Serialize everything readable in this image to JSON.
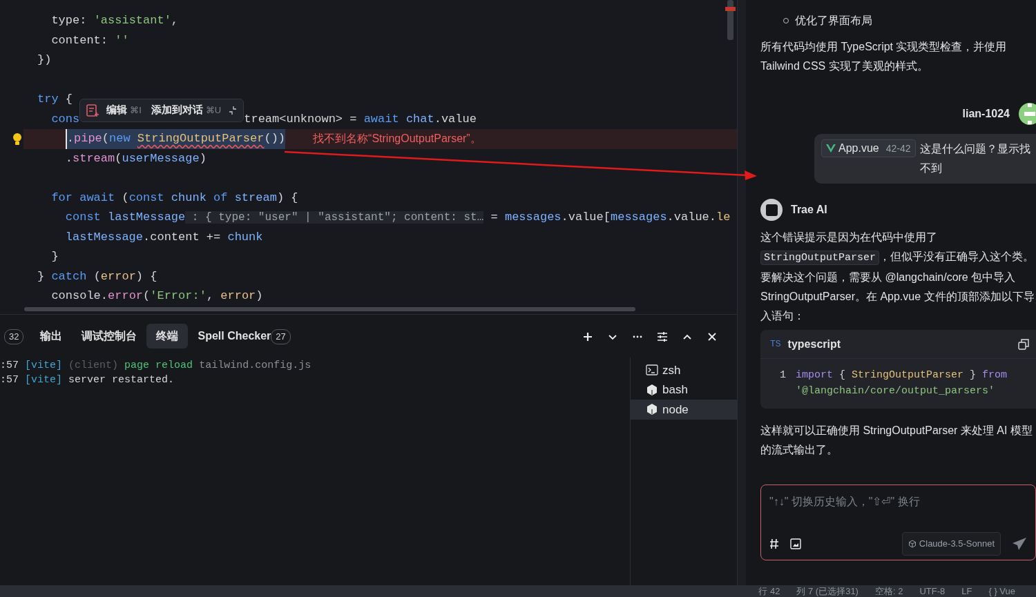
{
  "editor": {
    "lines": [
      {
        "kind": "code",
        "tokens": [
          {
            "t": "  type: ",
            "kind": "plain"
          },
          {
            "t": "'assistant'",
            "kind": "str"
          },
          {
            "t": ",",
            "kind": "plain"
          }
        ]
      },
      {
        "kind": "code",
        "tokens": [
          {
            "t": "  content: ",
            "kind": "plain"
          },
          {
            "t": "''",
            "kind": "str"
          }
        ]
      },
      {
        "kind": "code",
        "tokens": [
          {
            "t": "})",
            "kind": "plain"
          }
        ]
      },
      {
        "kind": "blank"
      },
      {
        "kind": "code",
        "tokens": [
          {
            "t": "try",
            "kind": "kw"
          },
          {
            "t": " {",
            "kind": "plain"
          }
        ]
      },
      {
        "kind": "covered",
        "before": [
          {
            "t": "  cons",
            "kind": "kw"
          }
        ],
        "after": [
          {
            "t": "tream<unknown> = ",
            "kind": "plain"
          },
          {
            "t": "await ",
            "kind": "kw"
          },
          {
            "t": "chat",
            "kind": "var"
          },
          {
            "t": ".value",
            "kind": "plain"
          }
        ]
      },
      {
        "kind": "error",
        "selection": [
          {
            "t": ".",
            "kind": "plain"
          },
          {
            "t": "pipe",
            "kind": "fn"
          },
          {
            "t": "(",
            "kind": "plain"
          },
          {
            "t": "new ",
            "kind": "kw"
          },
          {
            "t": "StringOutputParser",
            "kind": "unresolved"
          },
          {
            "t": "())",
            "kind": "plain"
          }
        ],
        "message": "找不到名称“StringOutputParser”。"
      },
      {
        "kind": "code",
        "tokens": [
          {
            "t": "    .",
            "kind": "plain"
          },
          {
            "t": "stream",
            "kind": "fn"
          },
          {
            "t": "(",
            "kind": "plain"
          },
          {
            "t": "userMessage",
            "kind": "var"
          },
          {
            "t": ")",
            "kind": "plain"
          }
        ]
      },
      {
        "kind": "blank"
      },
      {
        "kind": "code",
        "tokens": [
          {
            "t": "  for await ",
            "kind": "kw"
          },
          {
            "t": "(",
            "kind": "plain"
          },
          {
            "t": "const ",
            "kind": "kw"
          },
          {
            "t": "chunk ",
            "kind": "var"
          },
          {
            "t": "of ",
            "kind": "kw"
          },
          {
            "t": "stream",
            "kind": "var"
          },
          {
            "t": ") {",
            "kind": "plain"
          }
        ]
      },
      {
        "kind": "code",
        "tokens": [
          {
            "t": "    const ",
            "kind": "kw"
          },
          {
            "t": "lastMessage",
            "kind": "var"
          },
          {
            "t": " : { type: \"user\" | \"assistant\"; content: st…",
            "kind": "hint"
          },
          {
            "t": " = ",
            "kind": "plain"
          },
          {
            "t": "messages",
            "kind": "var"
          },
          {
            "t": ".value[",
            "kind": "plain"
          },
          {
            "t": "messages",
            "kind": "var"
          },
          {
            "t": ".value.",
            "kind": "plain"
          },
          {
            "t": "le",
            "kind": "type"
          }
        ]
      },
      {
        "kind": "code",
        "tokens": [
          {
            "t": "    lastMessage",
            "kind": "var"
          },
          {
            "t": ".content += ",
            "kind": "plain"
          },
          {
            "t": "chunk",
            "kind": "var"
          }
        ]
      },
      {
        "kind": "code",
        "tokens": [
          {
            "t": "  }",
            "kind": "plain"
          }
        ]
      },
      {
        "kind": "code",
        "tokens": [
          {
            "t": "} ",
            "kind": "plain"
          },
          {
            "t": "catch ",
            "kind": "kw"
          },
          {
            "t": "(",
            "kind": "plain"
          },
          {
            "t": "error",
            "kind": "param"
          },
          {
            "t": ") {",
            "kind": "plain"
          }
        ]
      },
      {
        "kind": "code",
        "tokens": [
          {
            "t": "  console.",
            "kind": "plain"
          },
          {
            "t": "error",
            "kind": "fn"
          },
          {
            "t": "(",
            "kind": "plain"
          },
          {
            "t": "'Error:'",
            "kind": "str"
          },
          {
            "t": ", ",
            "kind": "plain"
          },
          {
            "t": "error",
            "kind": "param"
          },
          {
            "t": ")",
            "kind": "plain"
          }
        ]
      }
    ],
    "hover_toolbar": {
      "items": [
        {
          "label": "编辑",
          "shortcut": "⌘I"
        },
        {
          "label": "添加到对话",
          "shortcut": "⌘U"
        }
      ]
    }
  },
  "panel": {
    "tabs": [
      {
        "badge": "32",
        "selected": false
      },
      {
        "label": "输出",
        "selected": false
      },
      {
        "label": "调试控制台",
        "selected": false
      },
      {
        "label": "终端",
        "selected": true
      },
      {
        "label": "Spell Checker",
        "badge": "27",
        "selected": false
      }
    ],
    "terminal_lines": [
      {
        "time": ":57",
        "tag": "[vite]",
        "parts": [
          {
            "t": "(client)",
            "kind": "dim"
          },
          {
            "t": "page reload",
            "kind": "green"
          },
          {
            "t": "tailwind.config.js",
            "kind": "muted"
          }
        ]
      },
      {
        "time": ":57",
        "tag": "[vite]",
        "parts": [
          {
            "t": "server restarted.",
            "kind": "plain"
          }
        ]
      }
    ],
    "sessions": [
      {
        "name": "zsh",
        "kind": "terminal",
        "selected": false
      },
      {
        "name": "bash",
        "kind": "node",
        "selected": false
      },
      {
        "name": "node",
        "kind": "node",
        "selected": true
      }
    ]
  },
  "chat": {
    "bullet": "优化了界面布局",
    "summary": "所有代码均使用 TypeScript 实现类型检查，并使用 Tailwind CSS 实现了美观的样式。",
    "user": {
      "name": "lian-1024",
      "file_chip": {
        "name": "App.vue",
        "range": "42-42"
      },
      "text": "这是什么问题？显示找不到"
    },
    "ai": {
      "name": "Trae AI",
      "intro": [
        {
          "t": "这个错误提示是因为在代码中使用了",
          "kind": "text"
        },
        {
          "t": "StringOutputParser",
          "kind": "code"
        },
        {
          "t": "，但似乎没有正确导入这个类。要解决这个问题，需要从 @langchain/core 包中导入 StringOutputParser。在 App.vue 文件的顶部添加以下导入语句：",
          "kind": "text"
        }
      ],
      "code_block": {
        "badge": "TS",
        "language": "typescript",
        "line_number": "1",
        "tokens": [
          {
            "t": "import",
            "kind": "imp"
          },
          {
            "t": " { ",
            "kind": "plain"
          },
          {
            "t": "StringOutputParser",
            "kind": "type"
          },
          {
            "t": " } ",
            "kind": "plain"
          },
          {
            "t": "from ",
            "kind": "imp"
          },
          {
            "t": "'@langchain/core/output_parsers'",
            "kind": "str"
          }
        ]
      },
      "outro": "这样就可以正确使用 StringOutputParser 来处理 AI 模型的流式输出了。"
    },
    "input": {
      "placeholder": "\"↑↓\" 切换历史输入，\"⇧⏎\" 换行",
      "model": "Claude-3.5-Sonnet"
    }
  },
  "status_bar": [
    "行 42",
    "列 7 (已选择31)",
    "空格: 2",
    "UTF-8",
    "LF",
    "{ } Vue"
  ]
}
